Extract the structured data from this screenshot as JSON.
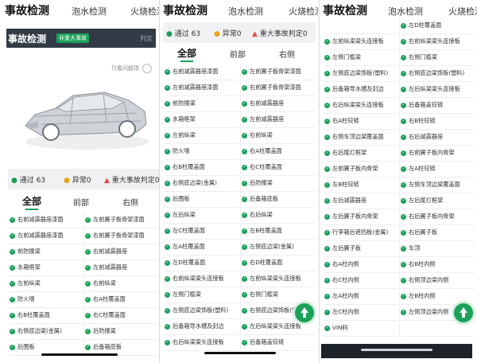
{
  "tabs": [
    "事故检测",
    "泡水检测",
    "火烧检测"
  ],
  "header": {
    "title": "事故检测",
    "badge": "非重大事故",
    "right_text": "判定"
  },
  "filter_only_issues": "只看问题项",
  "stats": {
    "pass_label": "通过",
    "pass_count": "63",
    "warn_label": "异常",
    "warn_count": "0",
    "major_label": "重大事故判定",
    "major_count": "0"
  },
  "filter_tabs": [
    "全部",
    "前部",
    "右侧"
  ],
  "items_panel1": [
    [
      "右前减震器座漆面",
      "左前翼子板骨架漆面"
    ],
    [
      "左前减震器座漆面",
      "右前翼子板骨架漆面"
    ],
    [
      "前防撞梁",
      "右前减震器座"
    ],
    [
      "水箱框架",
      "左前减震器座"
    ],
    [
      "左前纵梁",
      "右前纵梁"
    ],
    [
      "防火墙",
      "右A柱覆盖面"
    ],
    [
      "右B柱覆盖面",
      "右C柱覆盖面"
    ],
    [
      "右侧底边梁(金属)",
      "后防撞梁"
    ],
    [
      "后围板",
      "后备箱底板"
    ]
  ],
  "items_panel2": [
    [
      "右前减震器座漆面",
      "左前翼子板骨架漆面"
    ],
    [
      "左前减震器座漆面",
      "右前翼子板骨架漆面"
    ],
    [
      "前防撞梁",
      "右前减震器座"
    ],
    [
      "水箱框架",
      "左前减震器座"
    ],
    [
      "左前纵梁",
      "右前纵梁"
    ],
    [
      "防火墙",
      "右A柱覆盖面"
    ],
    [
      "右B柱覆盖面",
      "右C柱覆盖面"
    ],
    [
      "右侧底边梁(金属)",
      "后防撞梁"
    ],
    [
      "后围板",
      "后备箱底板"
    ],
    [
      "左后纵梁",
      "右后纵梁"
    ],
    [
      "左C柱覆盖面",
      "左B柱覆盖面"
    ],
    [
      "左A柱覆盖面",
      "左侧底边梁(金属)"
    ],
    [
      "左D柱覆盖面",
      "右D柱覆盖面"
    ],
    [
      "右前纵梁梁头连接板",
      "左前纵梁梁头连接板"
    ],
    [
      "左侧门槛梁",
      "右侧门槛梁"
    ],
    [
      "左侧底边梁饰板(塑料)",
      "右侧底边梁饰板(塑料)"
    ],
    [
      "后备箱导水槽及封边",
      "左后纵梁梁头连接板"
    ],
    [
      "右后纵梁梁头连接板",
      "后备箱盖铰链"
    ]
  ],
  "items_panel3": [
    [
      "",
      "左D柱覆盖面"
    ],
    [
      "左前纵梁梁头连接板",
      "右前纵梁梁头连接板"
    ],
    [
      "左侧门槛梁",
      "右侧门槛梁"
    ],
    [
      "左侧底边梁饰板(塑料)",
      "右侧底边梁饰板(塑料)"
    ],
    [
      "后备箱导水槽及封边",
      "左后纵梁梁头连接板"
    ],
    [
      "右后纵梁梁头连接板",
      "后备箱盖铰链"
    ],
    [
      "右A柱铰链",
      "右B柱铰链"
    ],
    [
      "右侧车顶边梁覆盖面",
      "右后减震器座"
    ],
    [
      "右后尾灯框架",
      "右前翼子板内骨架"
    ],
    [
      "左前翼子板内骨架",
      "左A柱铰链"
    ],
    [
      "左B柱铰链",
      "左侧车顶边梁覆盖面"
    ],
    [
      "左后减震器座",
      "左后尾灯框架"
    ],
    [
      "左后翼子板内骨架",
      "右后翼子板内骨架"
    ],
    [
      "行李箱后遮挡板(金属)",
      "右后翼子板"
    ],
    [
      "左后翼子板",
      "车顶"
    ],
    [
      "右A柱内侧",
      "右B柱内侧"
    ],
    [
      "右C柱内侧",
      "右侧顶边梁内侧"
    ],
    [
      "左A柱内侧",
      "左B柱内侧"
    ],
    [
      "左C柱内侧",
      "左侧顶边梁内侧"
    ],
    [
      "VIN码",
      ""
    ]
  ],
  "colors": {
    "accent": "#1aa15a",
    "header_bg": "#323a45",
    "warn": "#e8a317",
    "error": "#e34b4b"
  },
  "icons": {
    "pass": "check-circle-icon",
    "warn": "info-circle-icon",
    "major": "warning-triangle-icon",
    "fab": "upload-arrow-icon"
  }
}
